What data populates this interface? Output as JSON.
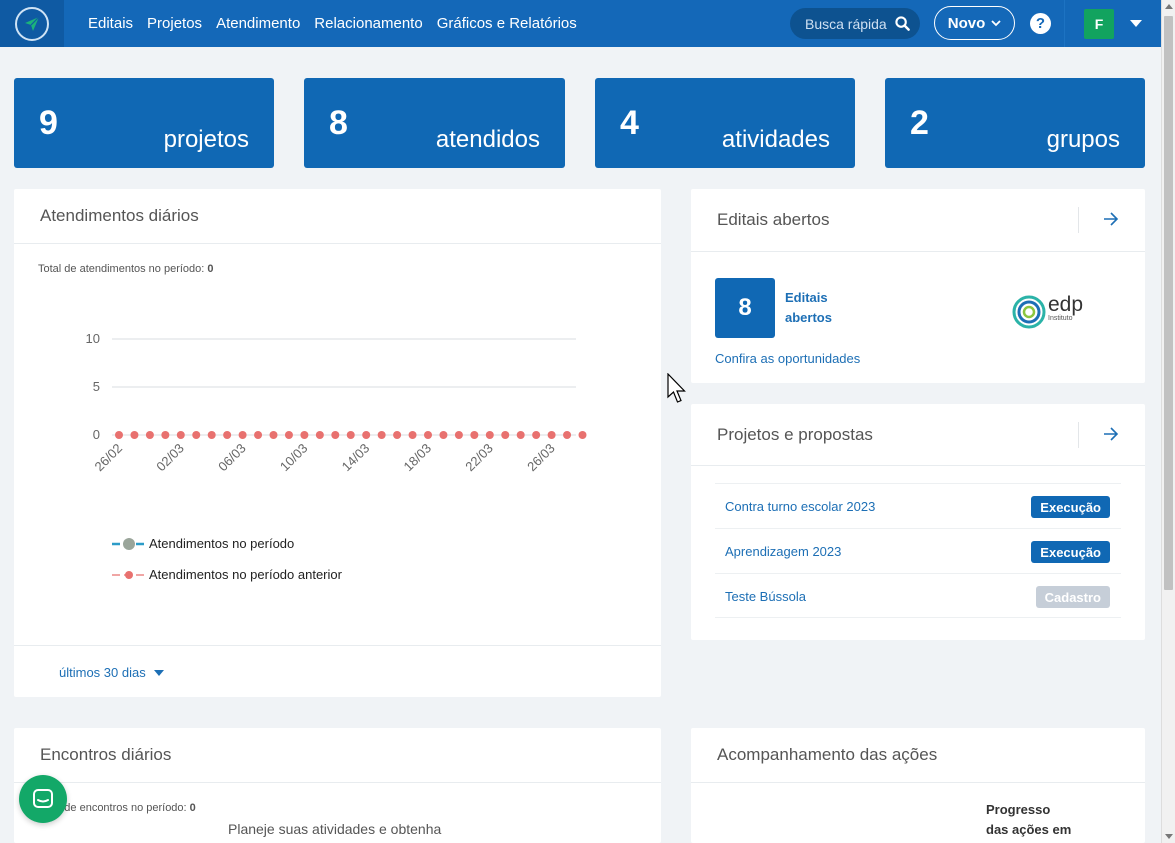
{
  "nav": {
    "items": [
      "Editais",
      "Projetos",
      "Atendimento",
      "Relacionamento",
      "Gráficos e Relatórios"
    ],
    "search_placeholder": "Busca rápida",
    "new_label": "Novo",
    "help_label": "?",
    "user_initial": "F"
  },
  "stats": [
    {
      "value": "9",
      "label": "projetos"
    },
    {
      "value": "8",
      "label": "atendidos"
    },
    {
      "value": "4",
      "label": "atividades"
    },
    {
      "value": "2",
      "label": "grupos"
    }
  ],
  "atendimentos": {
    "title": "Atendimentos diários",
    "total_label": "Total de atendimentos no período:",
    "total_value": "0",
    "period_label": "últimos 30 dias"
  },
  "chart_data": {
    "type": "line",
    "y_ticks": [
      "10",
      "5",
      "0"
    ],
    "ylim": [
      0,
      10
    ],
    "x_tick_labels": [
      "26/02",
      "02/03",
      "06/03",
      "10/03",
      "14/03",
      "18/03",
      "22/03",
      "26/03"
    ],
    "series": [
      {
        "name": "Atendimentos no período",
        "color": "#2c9cc8",
        "values": []
      },
      {
        "name": "Atendimentos no período anterior",
        "color": "#e8716f",
        "values": [
          0,
          0,
          0,
          0,
          0,
          0,
          0,
          0,
          0,
          0,
          0,
          0,
          0,
          0,
          0,
          0,
          0,
          0,
          0,
          0,
          0,
          0,
          0,
          0,
          0,
          0,
          0,
          0,
          0,
          0,
          0
        ]
      }
    ],
    "legend": "bottom-left",
    "grid": true
  },
  "editais": {
    "title": "Editais abertos",
    "count": "8",
    "count_label_1": "Editais",
    "count_label_2": "abertos",
    "link": "Confira as oportunidades",
    "partner_logo_text": "edp",
    "partner_logo_sub": "Instituto"
  },
  "projetos": {
    "title": "Projetos e propostas",
    "items": [
      {
        "name": "Contra turno escolar 2023",
        "status": "Execução",
        "status_color": "#1068b4"
      },
      {
        "name": "Aprendizagem 2023",
        "status": "Execução",
        "status_color": "#1068b4"
      },
      {
        "name": "Teste Bússola",
        "status": "Cadastro",
        "status_color": "#c6ced8"
      }
    ]
  },
  "encontros": {
    "title": "Encontros diários",
    "total_label": "Total de encontros no período:",
    "total_value": "0",
    "plan_text": "Planeje suas atividades e obtenha"
  },
  "acompanhamento": {
    "title": "Acompanhamento das ações",
    "progress_label_1": "Progresso",
    "progress_label_2": "das ações em"
  }
}
